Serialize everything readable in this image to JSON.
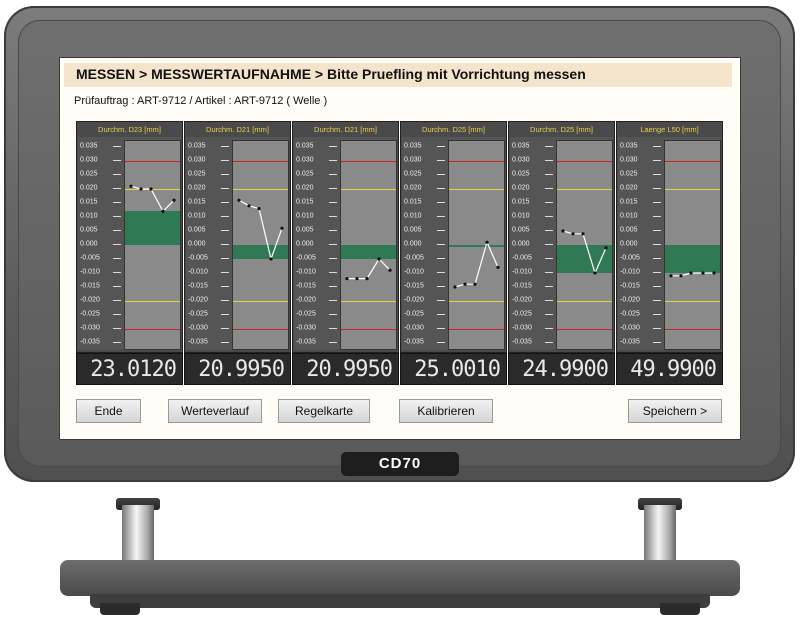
{
  "header": {
    "title": "MESSEN > MESSWERTAUFNAHME > Bitte Pruefling mit Vorrichtung messen"
  },
  "subheader": {
    "text": "Prüfauftrag : ART-9712 / Artikel : ART-9712 ( Welle )"
  },
  "scale_ticks": [
    "0.035",
    "0.030",
    "0.025",
    "0.020",
    "0.015",
    "0.010",
    "0.005",
    "0.000",
    "-0.005",
    "-0.010",
    "-0.015",
    "-0.020",
    "-0.025",
    "-0.030",
    "-0.035"
  ],
  "chart_data": {
    "type": "line",
    "y_range": [
      -0.035,
      0.035
    ],
    "reference_lines": {
      "red": [
        0.03,
        -0.03
      ],
      "yellow": [
        0.02,
        -0.02
      ]
    },
    "colors": {
      "red": "#d02020",
      "yellow": "#e6d43a",
      "band": "#2f7a54",
      "line": "#ffffff"
    },
    "panels": [
      {
        "title": "Durchm. D23 [mm]",
        "readout": "23.0120",
        "band": [
          0.0,
          0.012
        ],
        "values": [
          0.021,
          0.02,
          0.02,
          0.012,
          0.016
        ]
      },
      {
        "title": "Durchm. D21 [mm]",
        "readout": "20.9950",
        "band": [
          -0.005,
          0.0
        ],
        "values": [
          0.016,
          0.014,
          0.013,
          -0.005,
          0.006
        ]
      },
      {
        "title": "Durchm. D21 [mm]",
        "readout": "20.9950",
        "band": [
          -0.005,
          0.0
        ],
        "values": [
          -0.012,
          -0.012,
          -0.012,
          -0.005,
          -0.009
        ]
      },
      {
        "title": "Durchm. D25 [mm]",
        "readout": "25.0010",
        "band": [
          0.0,
          0.0
        ],
        "values": [
          -0.015,
          -0.014,
          -0.014,
          0.001,
          -0.008
        ]
      },
      {
        "title": "Durchm. D25 [mm]",
        "readout": "24.9900",
        "band": [
          -0.01,
          0.0
        ],
        "values": [
          0.005,
          0.004,
          0.004,
          -0.01,
          -0.001
        ]
      },
      {
        "title": "Laenge L50 [mm]",
        "readout": "49.9900",
        "band": [
          -0.01,
          0.0
        ],
        "values": [
          -0.011,
          -0.011,
          -0.01,
          -0.01,
          -0.01
        ]
      }
    ]
  },
  "buttons": {
    "ende": "Ende",
    "werteverlauf": "Werteverlauf",
    "regelkarte": "Regelkarte",
    "kalibrieren": "Kalibrieren",
    "speichern": "Speichern >"
  },
  "device": {
    "model": "CD70"
  }
}
